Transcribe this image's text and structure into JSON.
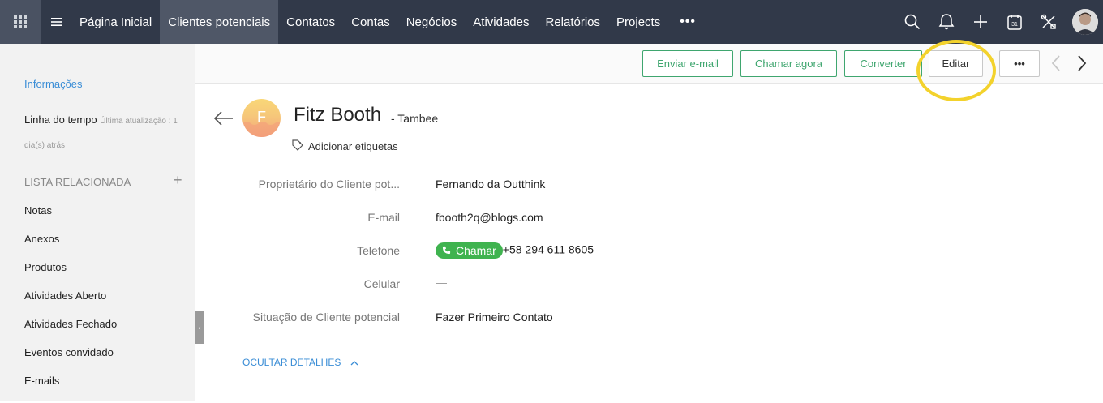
{
  "topnav": {
    "items": [
      {
        "label": "Página Inicial",
        "active": false
      },
      {
        "label": "Clientes potenciais",
        "active": true
      },
      {
        "label": "Contatos",
        "active": false
      },
      {
        "label": "Contas",
        "active": false
      },
      {
        "label": "Negócios",
        "active": false
      },
      {
        "label": "Atividades",
        "active": false
      },
      {
        "label": "Relatórios",
        "active": false
      },
      {
        "label": "Projects",
        "active": false
      }
    ],
    "more": "•••",
    "calendar_day": "31"
  },
  "sidebar": {
    "info_label": "Informações",
    "timeline_label": "Linha do tempo",
    "timeline_sub": "Última atualização : 1 dia(s) atrás",
    "related_title": "LISTA RELACIONADA",
    "related_add": "+",
    "items": [
      {
        "label": "Notas"
      },
      {
        "label": "Anexos"
      },
      {
        "label": "Produtos"
      },
      {
        "label": "Atividades Aberto"
      },
      {
        "label": "Atividades Fechado"
      },
      {
        "label": "Eventos convidado"
      },
      {
        "label": "E-mails"
      }
    ]
  },
  "actions": {
    "send_email": "Enviar e-mail",
    "call_now": "Chamar agora",
    "convert": "Converter",
    "edit": "Editar",
    "more": "•••"
  },
  "record": {
    "avatar_initial": "F",
    "name": "Fitz Booth",
    "company": "- Tambee",
    "add_tags": "Adicionar etiquetas",
    "fields": [
      {
        "label": "Proprietário do Cliente pot...",
        "value": "Fernando da Outthink"
      },
      {
        "label": "E-mail",
        "value": "fbooth2q@blogs.com"
      },
      {
        "label": "Telefone",
        "value": "+58 294 611 8605",
        "call_label": "Chamar"
      },
      {
        "label": "Celular",
        "value": "—"
      },
      {
        "label": "Situação de Cliente potencial",
        "value": "Fazer Primeiro Contato"
      }
    ],
    "hide_details": "OCULTAR DETALHES"
  },
  "colors": {
    "topbar": "#313949",
    "accent_green": "#3fa66f",
    "link_blue": "#3a8dd6",
    "highlight": "#f3d22c"
  }
}
